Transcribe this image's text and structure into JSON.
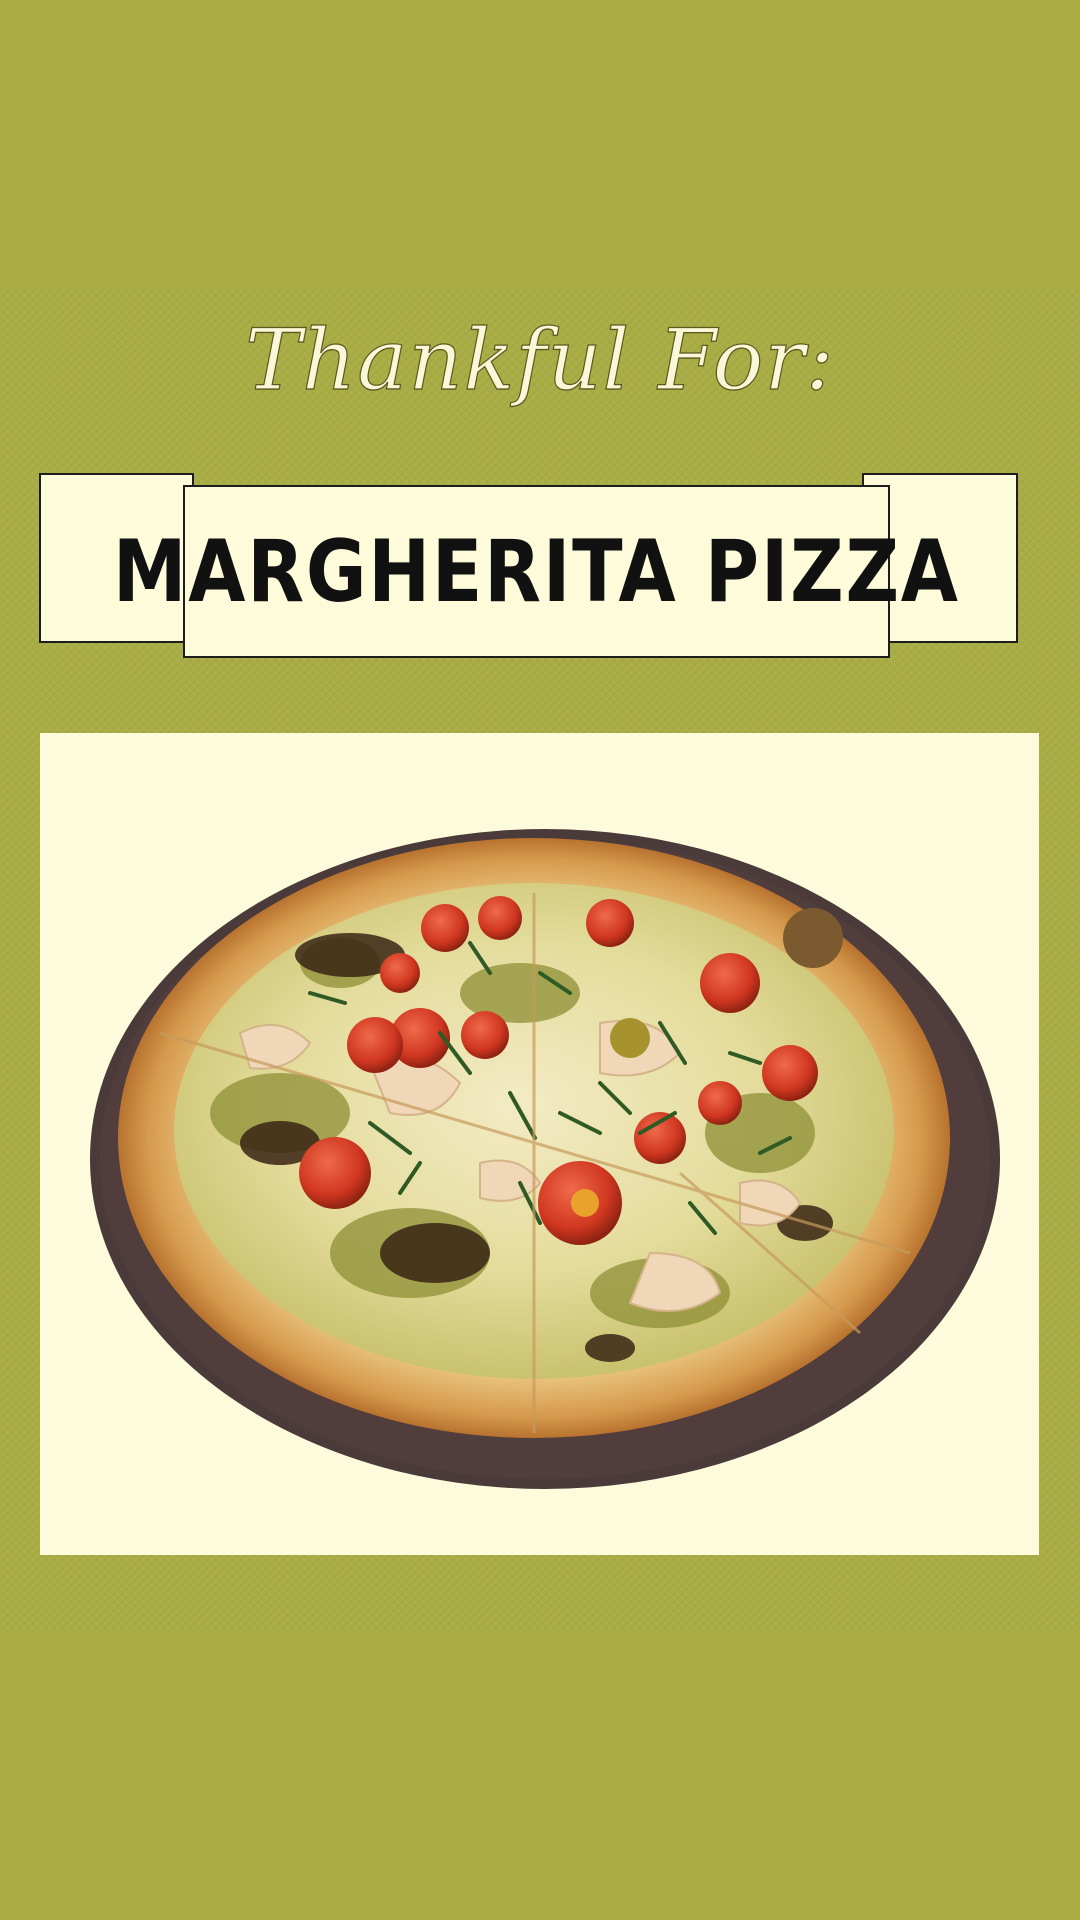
{
  "poster": {
    "headline": "Thankful For:",
    "title": "MARGHERITA PIZZA",
    "colors": {
      "background": "#a9ad44",
      "panel": "#fdfbda",
      "outline": "#1d1d1d",
      "headline_text": "#fbf8d9"
    },
    "photo": {
      "subject": "pizza-photo"
    }
  }
}
